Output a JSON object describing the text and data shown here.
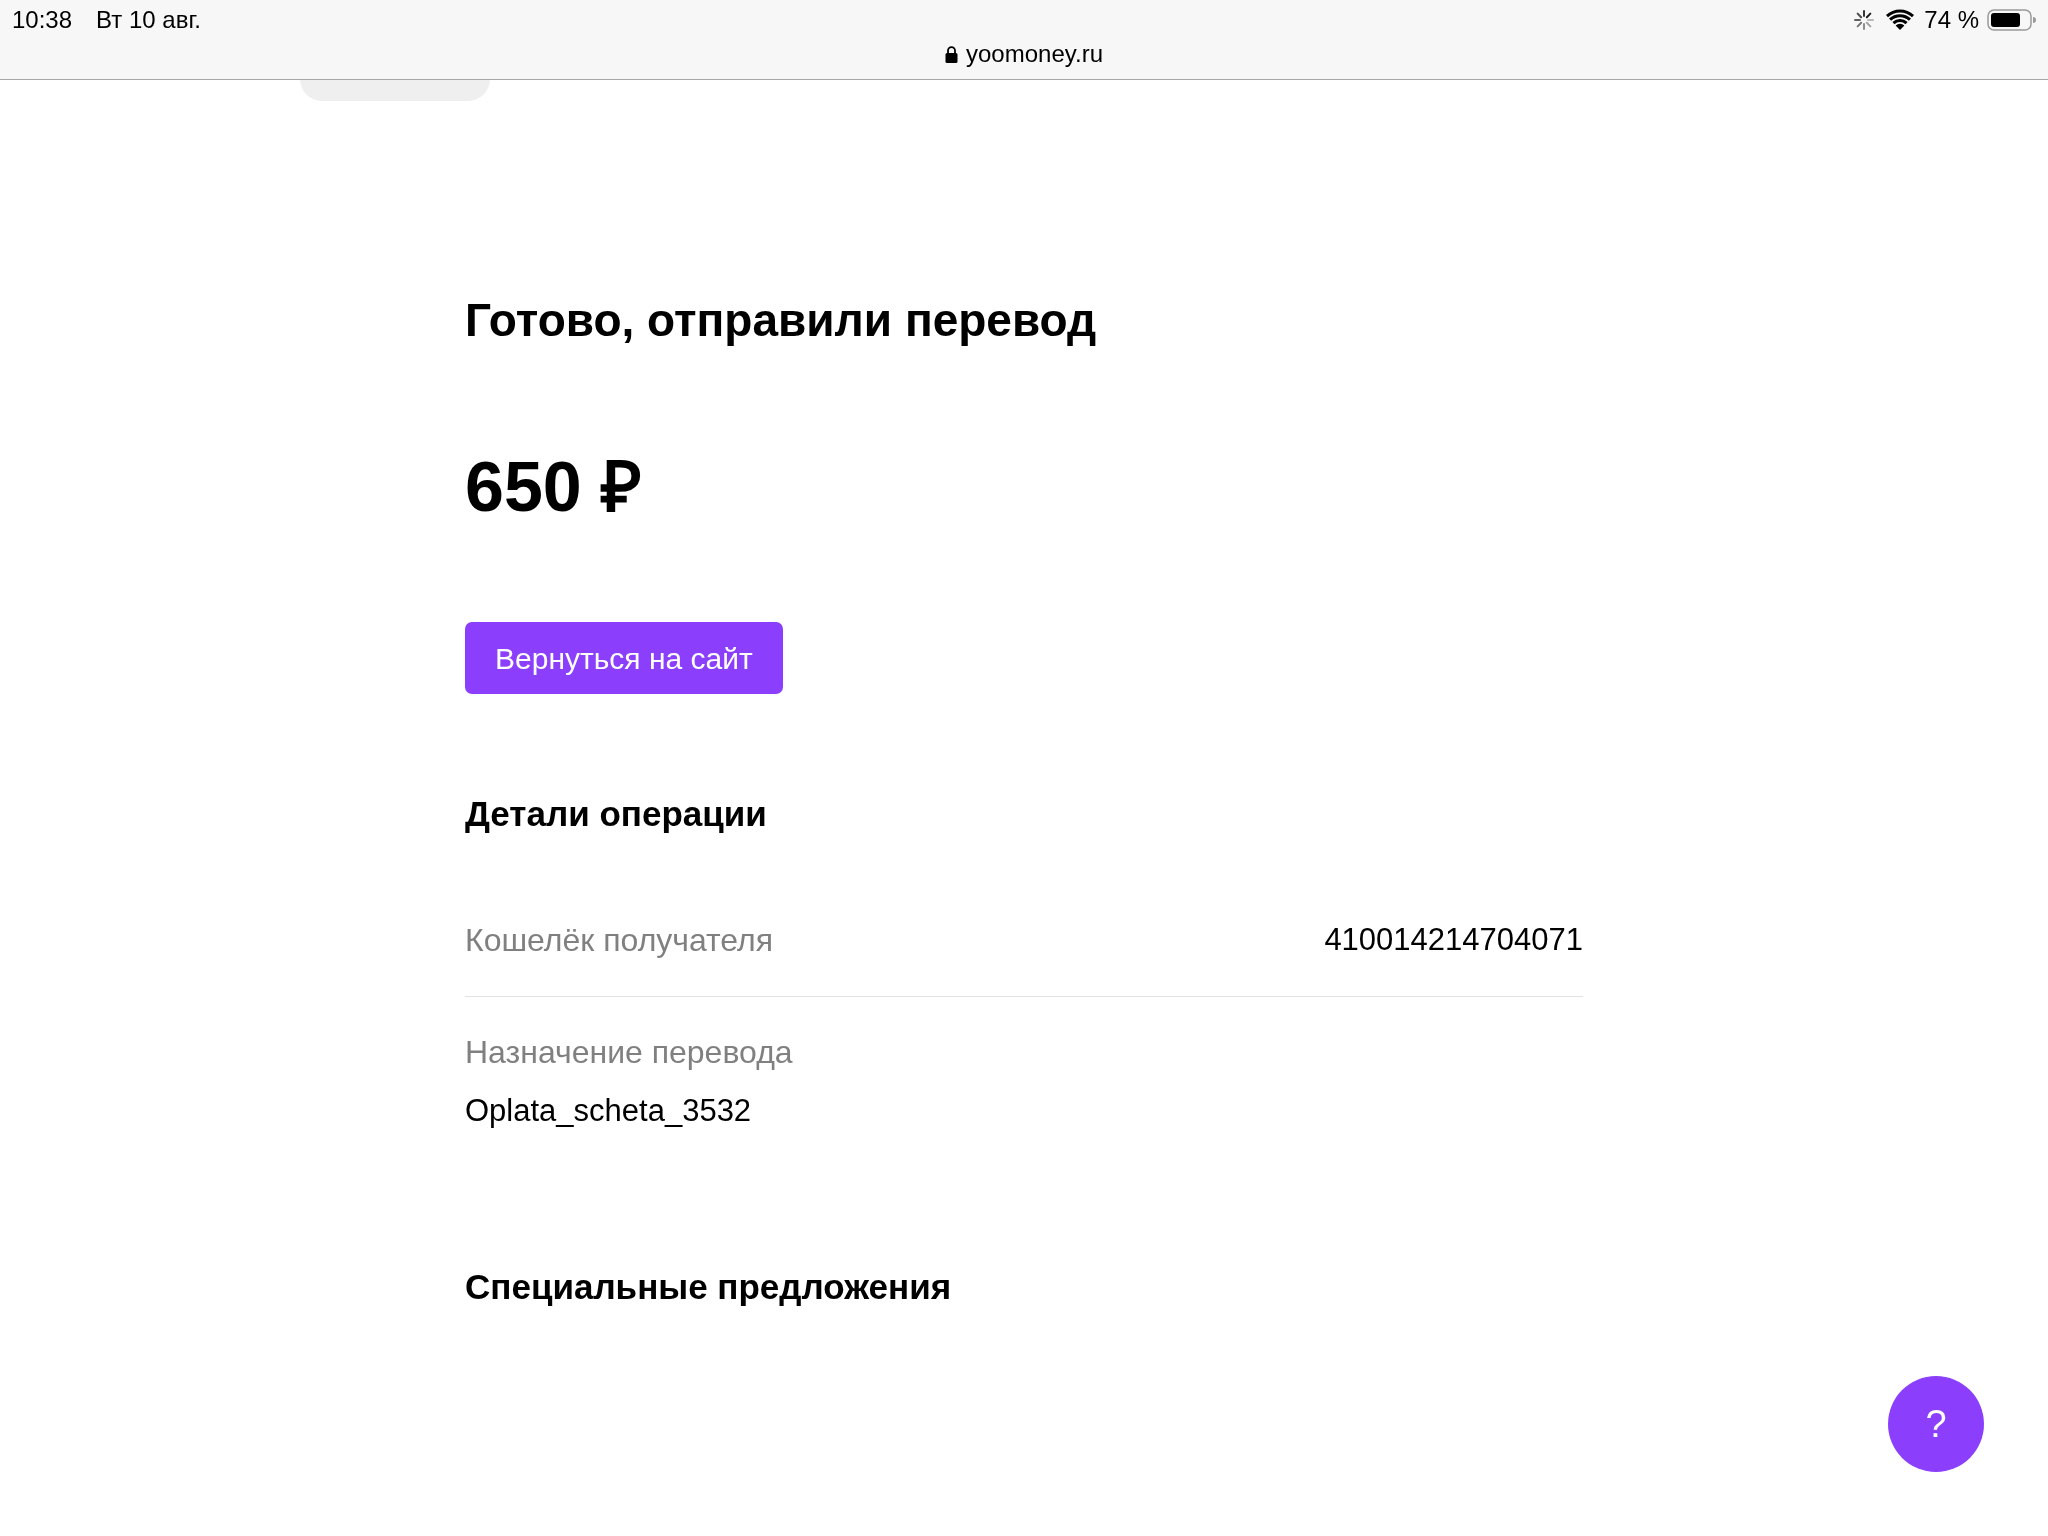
{
  "status_bar": {
    "time": "10:38",
    "date": "Вт 10 авг.",
    "loading": true,
    "battery": "74 %"
  },
  "address_bar": {
    "url": "yoomoney.ru",
    "secure": true
  },
  "page": {
    "title": "Готово, отправили перевод",
    "amount": "650 ₽",
    "return_button": "Вернуться на сайт",
    "details": {
      "heading": "Детали операции",
      "rows": [
        {
          "kind": "inline",
          "label": "Кошелёк получателя",
          "value": "410014214704071"
        },
        {
          "kind": "stacked",
          "label": "Назначение перевода",
          "value": "Oplata_scheta_3532"
        }
      ]
    },
    "offers": {
      "heading": "Специальные предложения"
    }
  },
  "help_button": {
    "label": "?"
  }
}
